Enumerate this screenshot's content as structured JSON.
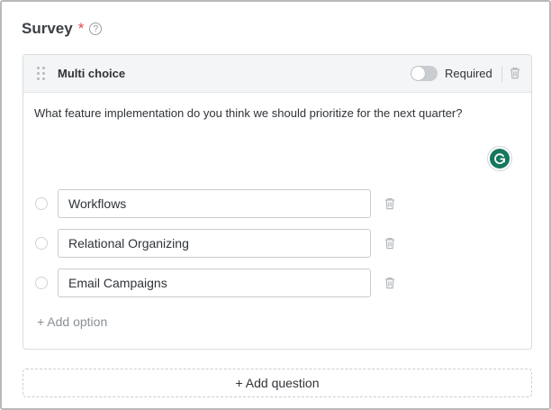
{
  "survey": {
    "title": "Survey",
    "required_marker": "*",
    "help_icon": "question-circle-icon"
  },
  "question_card": {
    "type_label": "Multi choice",
    "required_toggle": {
      "label": "Required",
      "on": false
    },
    "question_text": "What feature implementation do you think we should prioritize for the next quarter?",
    "options": [
      {
        "value": "Workflows"
      },
      {
        "value": "Relational Organizing"
      },
      {
        "value": "Email Campaigns"
      }
    ],
    "add_option_label": "+ Add option",
    "icons": {
      "drag": "drag-handle-icon",
      "delete": "trash-icon",
      "assistant": "grammarly-icon"
    },
    "colors": {
      "assistant_green": "#15785d",
      "required_red": "#e0474c"
    }
  },
  "add_question_label": "+ Add question"
}
